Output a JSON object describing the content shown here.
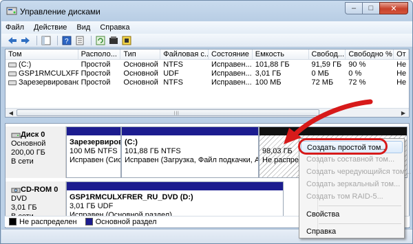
{
  "window": {
    "title": "Управление дисками",
    "buttons": {
      "minimize": "–",
      "maximize": "□",
      "close": "✕"
    }
  },
  "menu": [
    "Файл",
    "Действие",
    "Вид",
    "Справка"
  ],
  "toolbar": {
    "icons": [
      "back-arrow-icon",
      "forward-arrow-icon",
      "console-tree-icon",
      "help-icon",
      "properties-icon",
      "refresh-icon",
      "disk-settings-icon",
      "disk-action-icon"
    ]
  },
  "volumes": {
    "headers": [
      "Том",
      "Располо...",
      "Тип",
      "Файловая с...",
      "Состояние",
      "Емкость",
      "Свобод...",
      "Свободно %",
      "От"
    ],
    "rows": [
      [
        "(C:)",
        "Простой",
        "Основной",
        "NTFS",
        "Исправен...",
        "101,88 ГБ",
        "91,59 ГБ",
        "90 %",
        "Не"
      ],
      [
        "GSP1RMCULXFRE...",
        "Простой",
        "Основной",
        "UDF",
        "Исправен...",
        "3,01 ГБ",
        "0 МБ",
        "0 %",
        "Не"
      ],
      [
        "Зарезервировано...",
        "Простой",
        "Основной",
        "NTFS",
        "Исправен...",
        "100 МБ",
        "72 МБ",
        "72 %",
        "Не"
      ]
    ]
  },
  "disks": [
    {
      "name": "Диск 0",
      "lines": [
        "Основной",
        "200,00 ГБ",
        "В сети"
      ],
      "partitions": [
        {
          "title": "Зарезервиров",
          "size": "100 МБ NTFS",
          "status": "Исправен (Сис"
        },
        {
          "title": "(C:)",
          "size": "101,88 ГБ NTFS",
          "status": "Исправен (Загрузка, Файл подкачки, Авар"
        },
        {
          "title": "",
          "size": "98,03 ГБ",
          "status": "Не распред"
        }
      ]
    },
    {
      "name": "CD-ROM 0",
      "lines": [
        "DVD",
        "3,01 ГБ",
        "В сети"
      ],
      "partitions": [
        {
          "title": "GSP1RMCULXFRER_RU_DVD  (D:)",
          "size": "3,01 ГБ UDF",
          "status": "Исправен (Основной раздел)"
        }
      ]
    }
  ],
  "legend": [
    {
      "label": "Не распределен",
      "color": "#000000"
    },
    {
      "label": "Основной раздел",
      "color": "#1c1c8f"
    }
  ],
  "context_menu": {
    "items": [
      {
        "label": "Создать простой том...",
        "disabled": false
      },
      {
        "label": "Создать составной том...",
        "disabled": true
      },
      {
        "label": "Создать чередующийся том...",
        "disabled": true
      },
      {
        "label": "Создать зеркальный том...",
        "disabled": true
      },
      {
        "label": "Создать том RAID-5...",
        "disabled": true
      },
      {
        "label": "Свойства",
        "disabled": false
      },
      {
        "label": "Справка",
        "disabled": false
      }
    ]
  },
  "colors": {
    "accent_red": "#d71a1a",
    "primary_partition": "#1c1c8f"
  }
}
